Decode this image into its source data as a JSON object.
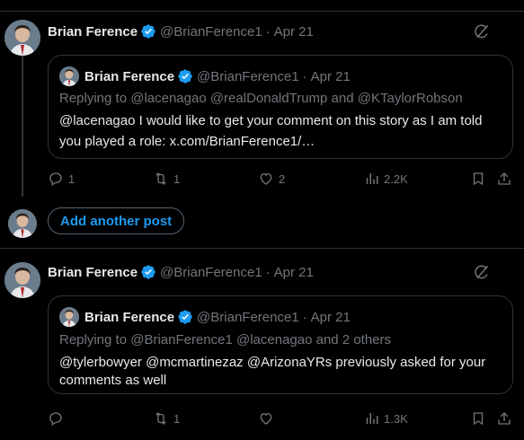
{
  "posts": [
    {
      "author": {
        "name": "Brian Ference",
        "handle": "@BrianFerence1",
        "date": "Apr 21"
      },
      "quote": {
        "author": {
          "name": "Brian Ference",
          "handle": "@BrianFerence1",
          "date": "Apr 21"
        },
        "replying_to": "Replying to @lacenagao @realDonaldTrump and @KTaylorRobson",
        "text_line1": "@lacenagao I would like to get your comment on this story as I am told",
        "text_line2": "you played a role: x.com/BrianFerence1/…"
      },
      "actions": {
        "replies": "1",
        "reposts": "1",
        "likes": "2",
        "views": "2.2K"
      }
    },
    {
      "author": {
        "name": "Brian Ference",
        "handle": "@BrianFerence1",
        "date": "Apr 21"
      },
      "quote": {
        "author": {
          "name": "Brian Ference",
          "handle": "@BrianFerence1",
          "date": "Apr 21"
        },
        "replying_to": "Replying to @BrianFerence1 @lacenagao and 2 others",
        "text_line1": "@tylerbowyer @mcmartinezaz @ArizonaYRs previously asked for your",
        "text_line2": "comments as well"
      },
      "actions": {
        "replies": "",
        "reposts": "1",
        "likes": "",
        "views": "1.3K"
      }
    }
  ],
  "add_post": {
    "label": "Add another post"
  },
  "dot": "·",
  "colors": {
    "accent": "#1d9bf0",
    "muted": "#71767b",
    "text": "#e7e9ea",
    "border": "#2f3336"
  }
}
